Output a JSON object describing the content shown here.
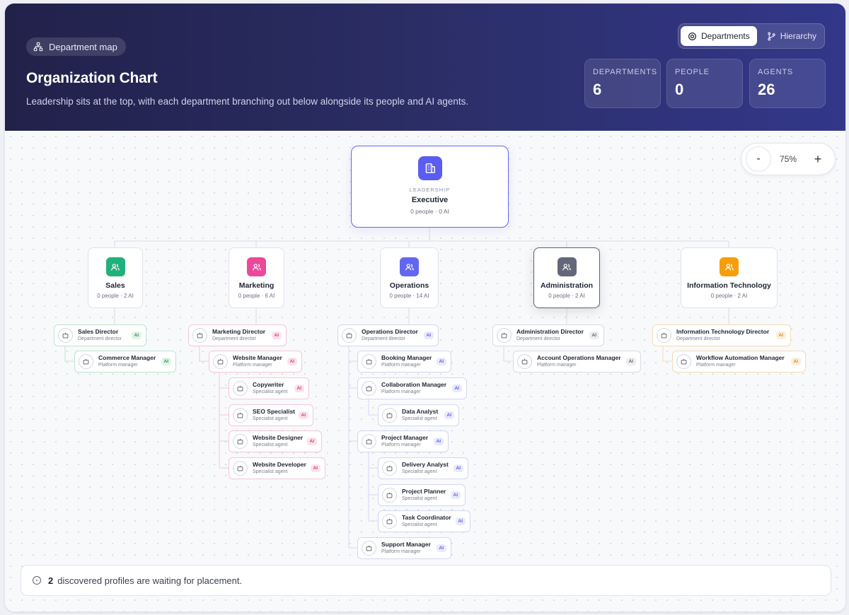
{
  "header": {
    "tag": "Department map",
    "title": "Organization Chart",
    "subtitle": "Leadership sits at the top, with each department branching out below alongside its people and AI agents.",
    "views": [
      "Departments",
      "Hierarchy"
    ],
    "stats": [
      {
        "label": "DEPARTMENTS",
        "value": "6"
      },
      {
        "label": "PEOPLE",
        "value": "0"
      },
      {
        "label": "AGENTS",
        "value": "26"
      }
    ]
  },
  "zoom": {
    "minus": "-",
    "value": "75%",
    "plus": "+"
  },
  "executive": {
    "kicker": "LEADERSHIP",
    "name": "Executive",
    "meta": "0 people · 0 AI"
  },
  "departments": [
    {
      "name": "Sales",
      "meta": "0 people · 2 AI",
      "color": "#22b07d"
    },
    {
      "name": "Marketing",
      "meta": "0 people · 6 AI",
      "color": "#ec4899"
    },
    {
      "name": "Operations",
      "meta": "0 people · 14 AI",
      "color": "#6366f1"
    },
    {
      "name": "Administration",
      "meta": "0 people · 2 AI",
      "color": "#64677a"
    },
    {
      "name": "Information Technology",
      "meta": "0 people · 2 AI",
      "color": "#f59e0b"
    }
  ],
  "ai_badge": "AI",
  "sales": [
    {
      "title": "Sales Director",
      "role": "Department director"
    },
    {
      "title": "Commerce Manager",
      "role": "Platform manager"
    }
  ],
  "marketing": [
    {
      "title": "Marketing Director",
      "role": "Department director"
    },
    {
      "title": "Website Manager",
      "role": "Platform manager"
    },
    {
      "title": "Copywriter",
      "role": "Specialist agent"
    },
    {
      "title": "SEO Specialist",
      "role": "Specialist agent"
    },
    {
      "title": "Website Designer",
      "role": "Specialist agent"
    },
    {
      "title": "Website Developer",
      "role": "Specialist agent"
    }
  ],
  "operations": [
    {
      "title": "Operations Director",
      "role": "Department director"
    },
    {
      "title": "Booking Manager",
      "role": "Platform manager"
    },
    {
      "title": "Collaboration Manager",
      "role": "Platform manager"
    },
    {
      "title": "Data Analyst",
      "role": "Specialist agent"
    },
    {
      "title": "Project Manager",
      "role": "Platform manager"
    },
    {
      "title": "Delivery Analyst",
      "role": "Specialist agent"
    },
    {
      "title": "Project Planner",
      "role": "Specialist agent"
    },
    {
      "title": "Task Coordinator",
      "role": "Specialist agent"
    },
    {
      "title": "Support Manager",
      "role": "Platform manager"
    }
  ],
  "administration": [
    {
      "title": "Administration Director",
      "role": "Department director"
    },
    {
      "title": "Account Operations Manager",
      "role": "Platform manager"
    }
  ],
  "it": [
    {
      "title": "Information Technology Director",
      "role": "Department director"
    },
    {
      "title": "Workflow Automation Manager",
      "role": "Platform manager"
    }
  ],
  "footer": {
    "count": "2",
    "text": "discovered profiles are waiting for placement."
  }
}
